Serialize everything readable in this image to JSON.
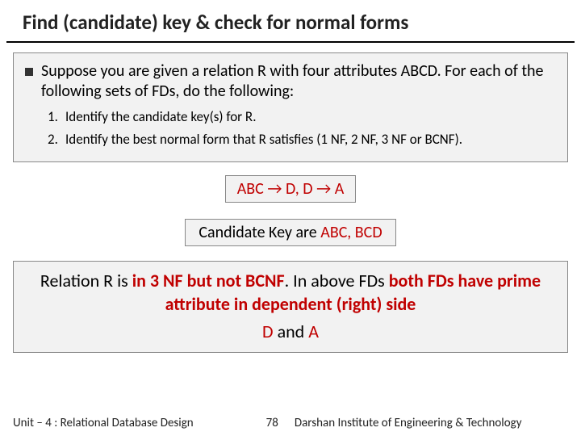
{
  "title": "Find (candidate) key & check for normal forms",
  "intro": "Suppose you are given a relation R with four attributes ABCD. For each of the following sets of FDs, do the following:",
  "steps": [
    {
      "num": "1.",
      "text": "Identify the candidate key(s) for R."
    },
    {
      "num": "2.",
      "text": "Identify the best normal form that R satisfies (1 NF, 2 NF, 3 NF or BCNF)."
    }
  ],
  "fd": "ABC → D, D → A",
  "ck_prefix": "Candidate Key are ",
  "ck_keys": "ABC, BCD",
  "result": {
    "p1a": "Relation R is ",
    "p1b": "in 3 NF but not BCNF",
    "p1c": ". In above FDs ",
    "p1d": "both FDs have prime attribute in dependent (right) side",
    "line2a": "D",
    "line2b": " and ",
    "line2c": "A"
  },
  "footer": {
    "left": "Unit – 4 : Relational Database Design",
    "page": "78",
    "right": "Darshan Institute of Engineering & Technology"
  }
}
